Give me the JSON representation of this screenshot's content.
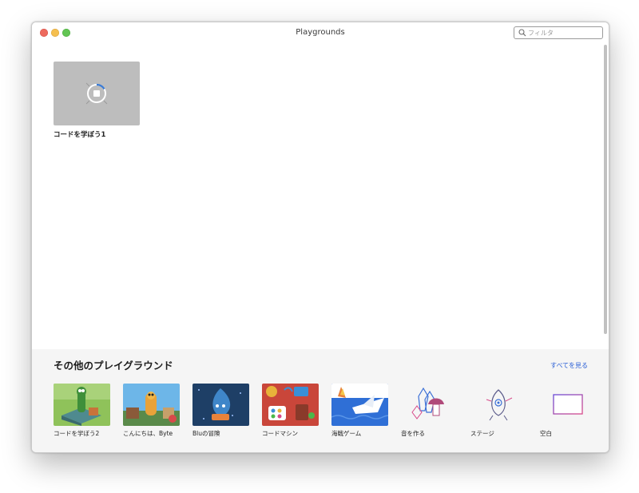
{
  "window": {
    "title": "Playgrounds"
  },
  "search": {
    "placeholder": "フィルタ",
    "value": ""
  },
  "documents": [
    {
      "name": "コードを学ぼう1"
    }
  ],
  "more": {
    "title": "その他のプレイグラウンド",
    "see_all": "すべてを見る",
    "templates": [
      {
        "label": "コードを学ぼう2"
      },
      {
        "label": "こんにちは、Byte"
      },
      {
        "label": "Bluの冒険"
      },
      {
        "label": "コードマシン"
      },
      {
        "label": "海戦ゲーム"
      },
      {
        "label": "音を作る"
      },
      {
        "label": "ステージ"
      },
      {
        "label": "空白"
      }
    ]
  },
  "colors": {
    "link": "#2a5fd6",
    "section_bg": "#f5f5f5",
    "thumb_gray": "#bdbdbd"
  }
}
